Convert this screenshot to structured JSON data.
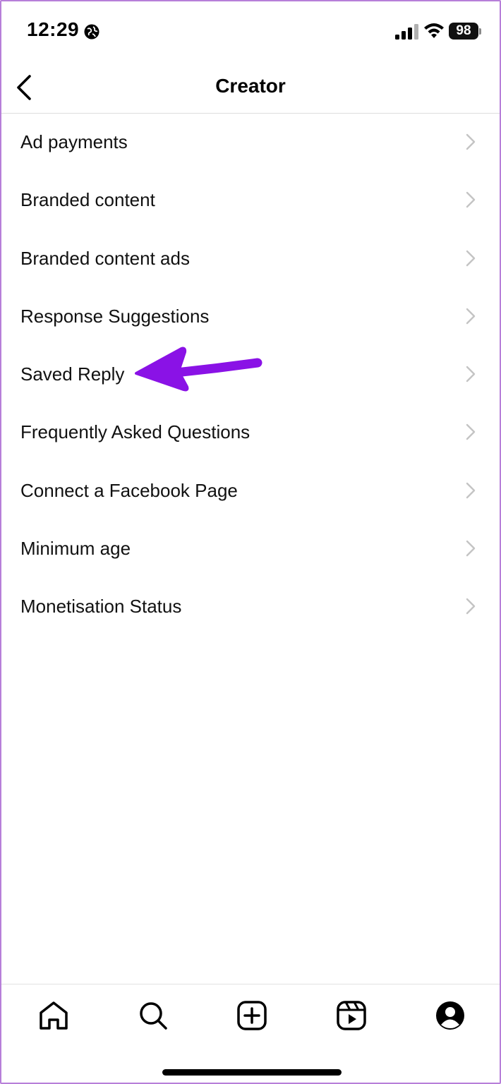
{
  "status_bar": {
    "time": "12:29",
    "battery": "98",
    "icons": [
      "globe-icon",
      "signal-icon",
      "wifi-icon",
      "battery-icon"
    ]
  },
  "header": {
    "title": "Creator",
    "back_icon": "chevron-left-icon"
  },
  "menu": {
    "items": [
      {
        "label": "Ad payments"
      },
      {
        "label": "Branded content"
      },
      {
        "label": "Branded content ads"
      },
      {
        "label": "Response Suggestions"
      },
      {
        "label": "Saved Reply"
      },
      {
        "label": "Frequently Asked Questions"
      },
      {
        "label": "Connect a Facebook Page"
      },
      {
        "label": "Minimum age"
      },
      {
        "label": "Monetisation Status"
      }
    ],
    "trailing_icon": "chevron-right-icon"
  },
  "annotation": {
    "type": "arrow",
    "points_to": "Saved Reply",
    "color": "#8a12e6"
  },
  "tab_bar": {
    "tabs": [
      "home-icon",
      "search-icon",
      "create-icon",
      "reels-icon",
      "profile-icon"
    ]
  },
  "colors": {
    "text": "#111111",
    "chevron": "#c4c4c4",
    "divider": "#dedede",
    "annotation": "#8a12e6"
  }
}
